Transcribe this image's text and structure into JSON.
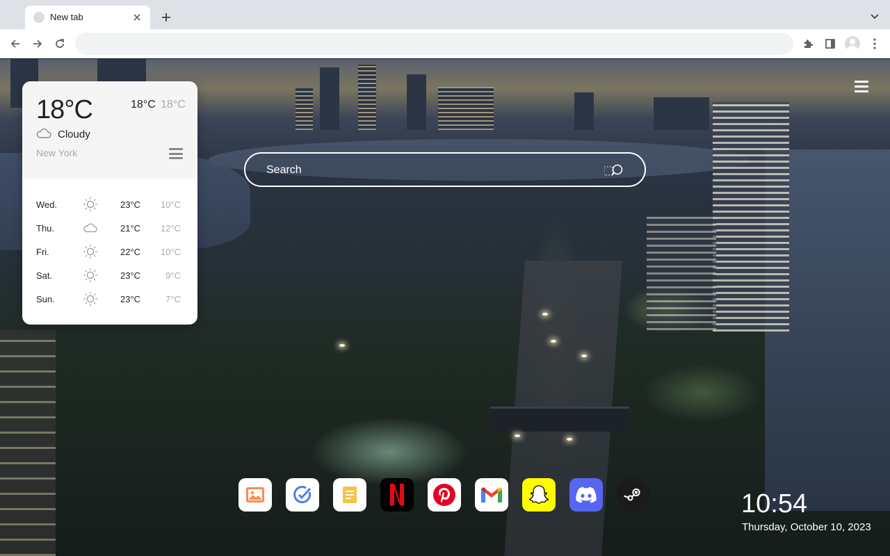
{
  "browser": {
    "tab": {
      "title": "New tab"
    },
    "address_bar": {
      "value": "",
      "placeholder": ""
    }
  },
  "weather": {
    "current_temp": "18°C",
    "high": "18°C",
    "low": "18°C",
    "condition": "Cloudy",
    "city": "New York",
    "forecast": [
      {
        "day": "Wed.",
        "icon": "sun-icon",
        "high": "23°C",
        "low": "10°C"
      },
      {
        "day": "Thu.",
        "icon": "cloud-icon",
        "high": "21°C",
        "low": "12°C"
      },
      {
        "day": "Fri.",
        "icon": "sun-icon",
        "high": "22°C",
        "low": "10°C"
      },
      {
        "day": "Sat.",
        "icon": "sun-icon",
        "high": "23°C",
        "low": "9°C"
      },
      {
        "day": "Sun.",
        "icon": "sun-icon",
        "high": "23°C",
        "low": "7°C"
      }
    ]
  },
  "search": {
    "placeholder": "Search"
  },
  "shortcuts": [
    {
      "name": "photos",
      "icon": "photo-icon",
      "color": "#ffffff"
    },
    {
      "name": "tasks",
      "icon": "check-icon",
      "color": "#ffffff"
    },
    {
      "name": "notes",
      "icon": "notes-icon",
      "color": "#ffffff"
    },
    {
      "name": "netflix",
      "icon": "netflix-icon",
      "color": "#000000"
    },
    {
      "name": "pinterest",
      "icon": "pinterest-icon",
      "color": "#ffffff"
    },
    {
      "name": "gmail",
      "icon": "gmail-icon",
      "color": "#ffffff"
    },
    {
      "name": "snapchat",
      "icon": "snapchat-icon",
      "color": "#fffc00"
    },
    {
      "name": "discord",
      "icon": "discord-icon",
      "color": "#5865f2"
    },
    {
      "name": "steam",
      "icon": "steam-icon",
      "color": "#1b1b1b"
    }
  ],
  "clock": {
    "time": "10:54",
    "date": "Thursday, October 10, 2023"
  }
}
